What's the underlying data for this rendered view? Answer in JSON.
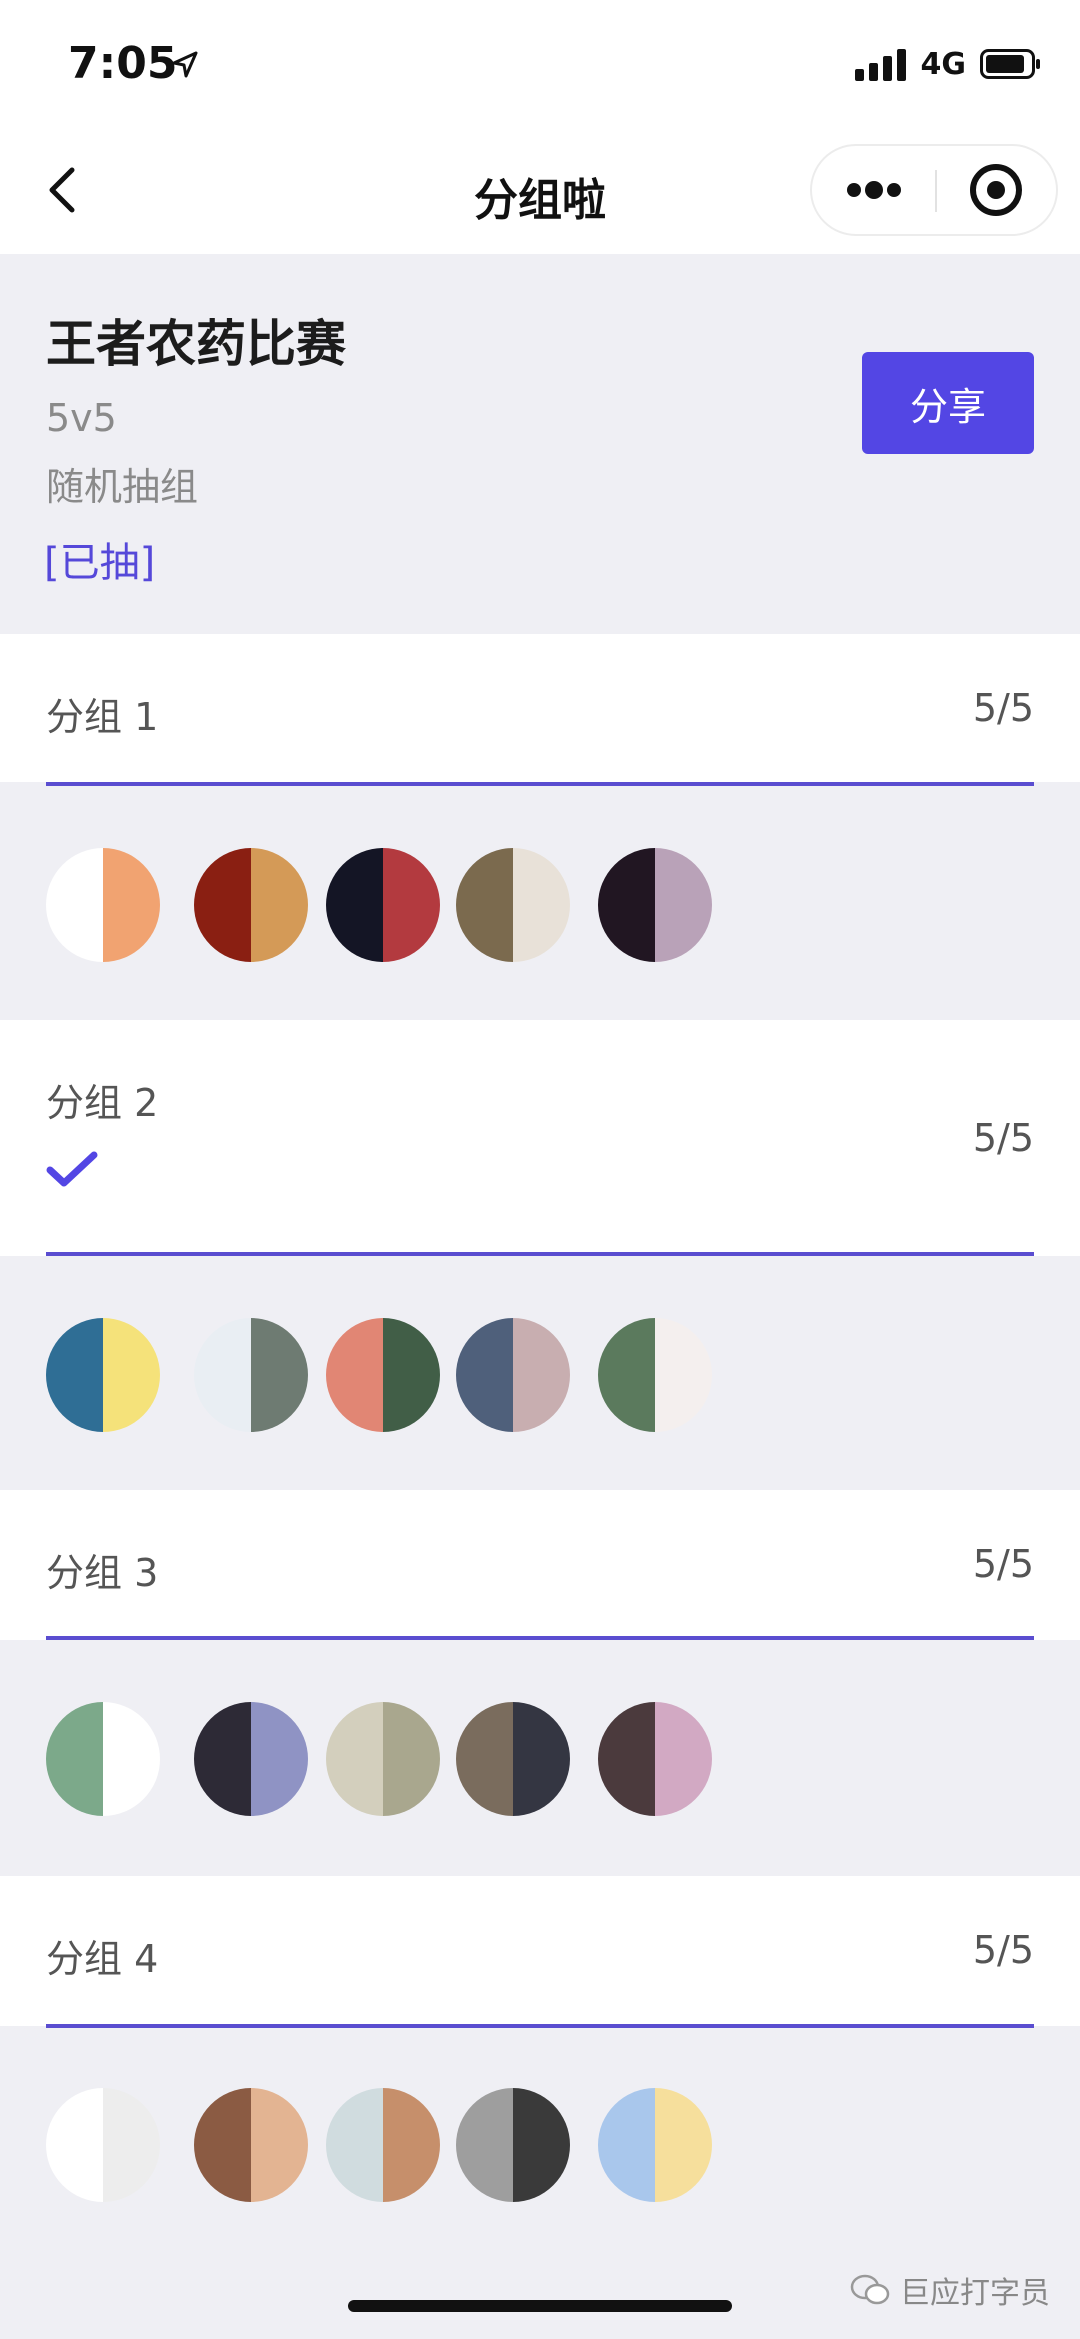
{
  "status_bar": {
    "time": "7:05",
    "network": "4G"
  },
  "nav": {
    "title": "分组啦"
  },
  "event": {
    "title": "王者农药比赛",
    "mode": "5v5",
    "method": "随机抽组",
    "status": "[已抽]",
    "share_label": "分享",
    "accent_color": "#5346e4"
  },
  "groups": [
    {
      "name": "分组 1",
      "count": "5/5",
      "checked": false,
      "avatars": [
        [
          "#ffffff",
          "#f1a371"
        ],
        [
          "#8a1f12",
          "#d49a57"
        ],
        [
          "#141525",
          "#b33a3f"
        ],
        [
          "#7b6a4e",
          "#e8e1d8"
        ],
        [
          "#211622",
          "#b9a2b8"
        ]
      ]
    },
    {
      "name": "分组 2",
      "count": "5/5",
      "checked": true,
      "avatars": [
        [
          "#2f6e95",
          "#f5e27a"
        ],
        [
          "#e9eef3",
          "#6e7b72"
        ],
        [
          "#e18674",
          "#415e47"
        ],
        [
          "#4f607b",
          "#c8aeb0"
        ],
        [
          "#5b7a5d",
          "#f4efee"
        ]
      ]
    },
    {
      "name": "分组 3",
      "count": "5/5",
      "checked": false,
      "avatars": [
        [
          "#7ca98a",
          "#ffffff"
        ],
        [
          "#2d2a36",
          "#8f93c4"
        ],
        [
          "#d3cfbd",
          "#a9a78e"
        ],
        [
          "#7a6c5d",
          "#343642"
        ],
        [
          "#4b3a3d",
          "#d2a9c3"
        ]
      ]
    },
    {
      "name": "分组 4",
      "count": "5/5",
      "checked": false,
      "avatars": [
        [
          "#ffffff",
          "#ededed"
        ],
        [
          "#8b5b43",
          "#e3b492"
        ],
        [
          "#d0dcdf",
          "#c68f6b"
        ],
        [
          "#9e9e9e",
          "#3a3a3a"
        ],
        [
          "#a9c7ec",
          "#f6df9c"
        ]
      ]
    }
  ],
  "watermark": "巨应打字员"
}
